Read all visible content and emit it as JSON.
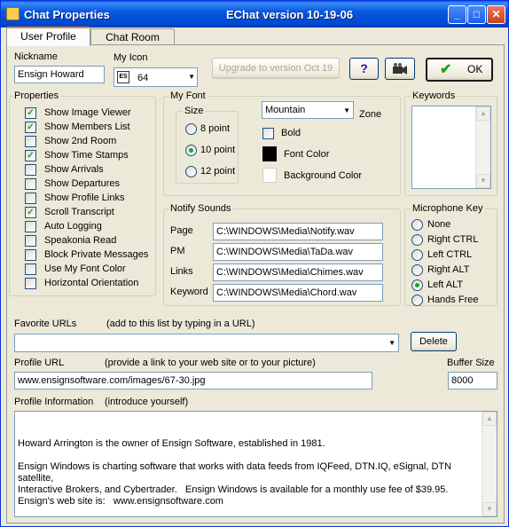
{
  "title": "Chat Properties",
  "version": "EChat version 10-19-06",
  "tabs": [
    "User Profile",
    "Chat Room"
  ],
  "nickname": {
    "label": "Nickname",
    "value": "Ensign Howard"
  },
  "my_icon": {
    "label": "My Icon",
    "value": "64",
    "badge": "ES"
  },
  "upgrade_button": "Upgrade to version Oct 19",
  "help_button": "?",
  "ok_button": "OK",
  "properties": {
    "label": "Properties",
    "items": [
      {
        "label": "Show Image Viewer",
        "checked": true
      },
      {
        "label": "Show Members List",
        "checked": true
      },
      {
        "label": "Show 2nd Room",
        "checked": false
      },
      {
        "label": "Show Time Stamps",
        "checked": true
      },
      {
        "label": "Show Arrivals",
        "checked": false
      },
      {
        "label": "Show Departures",
        "checked": false
      },
      {
        "label": "Show Profile Links",
        "checked": false
      },
      {
        "label": "Scroll Transcript",
        "checked": true
      },
      {
        "label": "Auto Logging",
        "checked": false
      },
      {
        "label": "Speakonia Read",
        "checked": false
      },
      {
        "label": "Block Private Messages",
        "checked": false
      },
      {
        "label": "Use My Font Color",
        "checked": false
      },
      {
        "label": "Horizontal Orientation",
        "checked": false
      }
    ]
  },
  "my_font": {
    "label": "My Font",
    "size_label": "Size",
    "sizes": [
      {
        "label": "8 point",
        "selected": false
      },
      {
        "label": "10 point",
        "selected": true
      },
      {
        "label": "12 point",
        "selected": false
      }
    ],
    "font_value": "Mountain",
    "zone_label": "Zone",
    "bold_label": "Bold",
    "font_color_label": "Font Color",
    "background_color_label": "Background Color",
    "font_color": "#000000",
    "background_color": "#ffffff"
  },
  "keywords": {
    "label": "Keywords"
  },
  "notify_sounds": {
    "label": "Notify Sounds",
    "rows": [
      {
        "label": "Page",
        "value": "C:\\WINDOWS\\Media\\Notify.wav"
      },
      {
        "label": "PM",
        "value": "C:\\WINDOWS\\Media\\TaDa.wav"
      },
      {
        "label": "Links",
        "value": "C:\\WINDOWS\\Media\\Chimes.wav"
      },
      {
        "label": "Keyword",
        "value": "C:\\WINDOWS\\Media\\Chord.wav"
      }
    ]
  },
  "microphone_key": {
    "label": "Microphone Key",
    "options": [
      {
        "label": "None",
        "selected": false
      },
      {
        "label": "Right CTRL",
        "selected": false
      },
      {
        "label": "Left CTRL",
        "selected": false
      },
      {
        "label": "Right ALT",
        "selected": false
      },
      {
        "label": "Left ALT",
        "selected": true
      },
      {
        "label": "Hands Free",
        "selected": false
      }
    ]
  },
  "favorite_urls": {
    "label": "Favorite URLs",
    "hint": "(add to this list by typing in a URL)",
    "value": "",
    "delete_button": "Delete"
  },
  "profile_url": {
    "label": "Profile URL",
    "hint": "(provide a link to your web site or to your picture)",
    "value": "www.ensignsoftware.com/images/67-30.jpg"
  },
  "buffer_size": {
    "label": "Buffer Size",
    "value": "8000"
  },
  "profile_info": {
    "label": "Profile Information",
    "hint": "(introduce yourself)",
    "text": "Howard Arrington is the owner of Ensign Software, established in 1981.\n\nEnsign Windows is charting software that works with data feeds from IQFeed, DTN.IQ, eSignal, DTN satellite,\nInteractive Brokers, and Cybertrader.   Ensign Windows is available for a monthly use fee of $39.95.\nEnsign's web site is:   www.ensignsoftware.com"
  },
  "colors": {
    "titlebar": "#0054e3",
    "dialog": "#ece9d8",
    "check": "#21a121"
  }
}
